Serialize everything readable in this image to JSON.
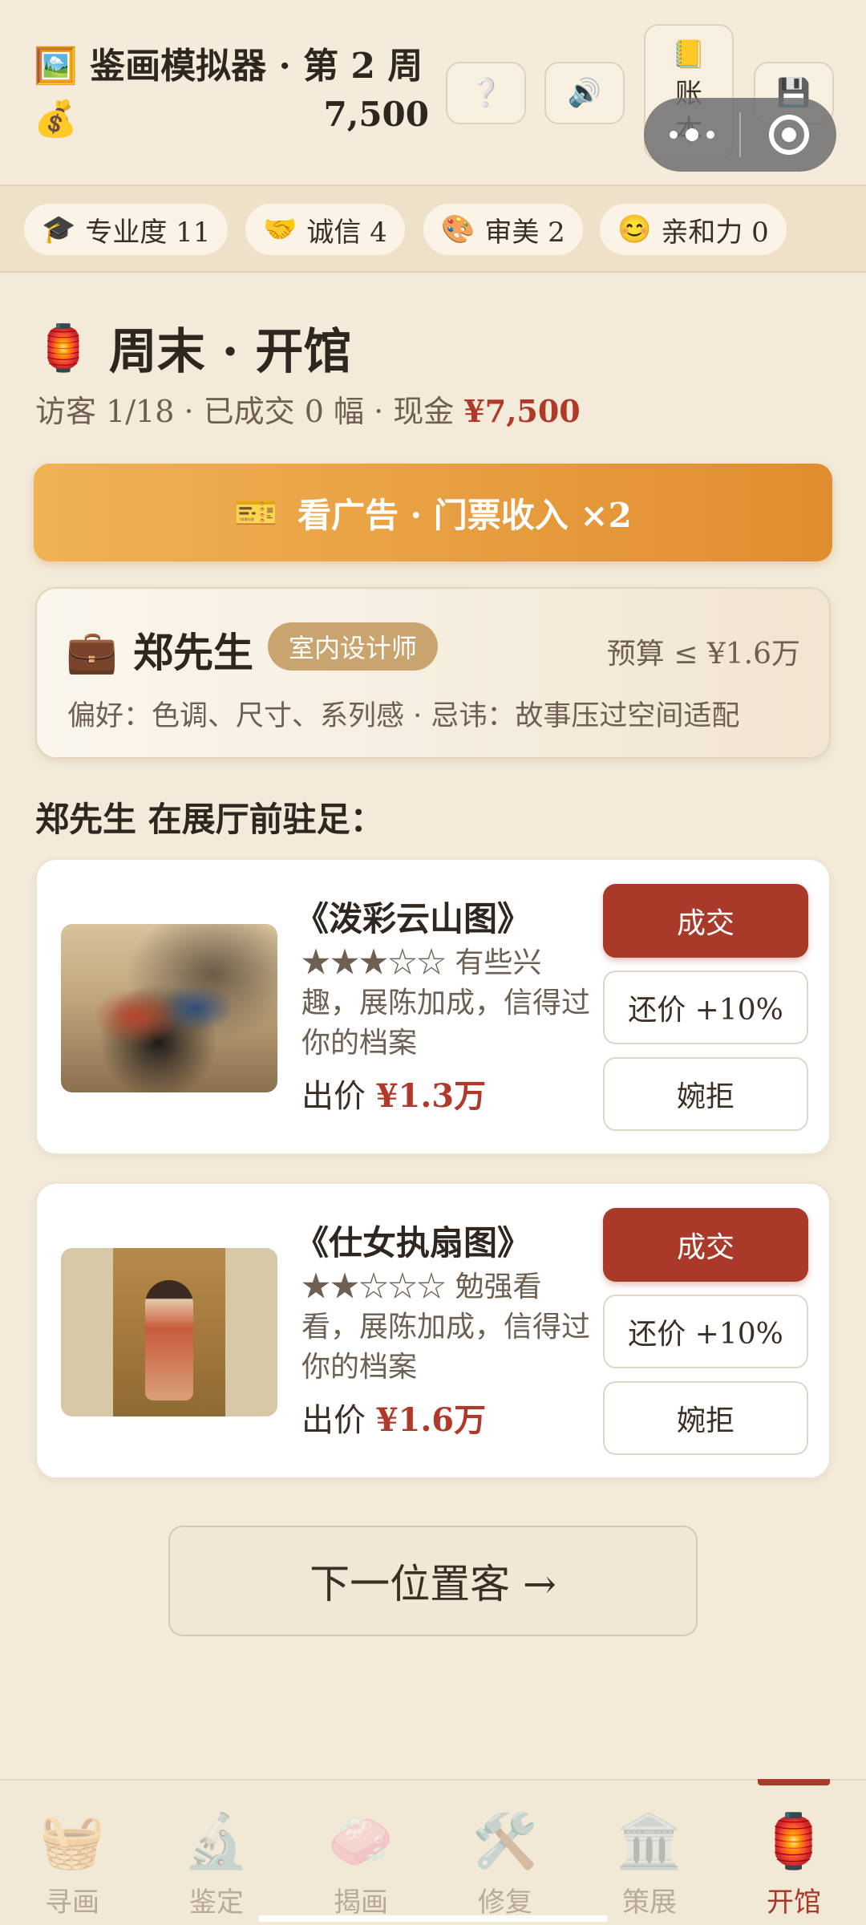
{
  "header": {
    "icon": "framed-picture",
    "title": "鉴画模拟器 · 第 2 周",
    "money_icon": "money-bag",
    "cash": "7,500",
    "help_glyph": "❔",
    "sound_icon": "speaker",
    "ledger_icon": "ledger-book",
    "ledger_label": "账本",
    "save_icon": "floppy-disk"
  },
  "stats": [
    {
      "icon": "graduation-cap",
      "label": "专业度 11"
    },
    {
      "icon": "handshake",
      "label": "诚信 4"
    },
    {
      "icon": "palette",
      "label": "审美 2"
    },
    {
      "icon": "smile",
      "label": "亲和力 0"
    }
  ],
  "session": {
    "icon": "lantern",
    "title": "周末 · 开馆",
    "subline_prefix": "访客 1/18 · 已成交 0 幅 · 现金 ",
    "cash": "¥7,500"
  },
  "ad_button": {
    "icon": "ticket",
    "label": "看广告 · 门票收入 ×2"
  },
  "customer": {
    "icon": "briefcase",
    "name": "郑先生",
    "role": "室内设计师",
    "budget": "预算 ≤ ¥1.6万",
    "prefs": "偏好：色调、尺寸、系列感 · 忌讳：故事压过空间适配"
  },
  "prompt": "郑先生 在展厅前驻足：",
  "offers": [
    {
      "title": "《泼彩云山图》",
      "desc": "★★★☆☆ 有些兴趣，展陈加成，信得过你的档案",
      "price_label": "出价 ",
      "price": "¥1.3万",
      "deal": "成交",
      "counter": "还价 +10%",
      "decline": "婉拒"
    },
    {
      "title": "《仕女执扇图》",
      "desc": "★★☆☆☆ 勉强看看，展陈加成，信得过你的档案",
      "price_label": "出价 ",
      "price": "¥1.6万",
      "deal": "成交",
      "counter": "还价 +10%",
      "decline": "婉拒"
    }
  ],
  "next_button": "下一位置客 →",
  "tabs": [
    {
      "icon": "basket",
      "label": "寻画"
    },
    {
      "icon": "microscope",
      "label": "鉴定"
    },
    {
      "icon": "soap",
      "label": "揭画"
    },
    {
      "icon": "tools",
      "label": "修复"
    },
    {
      "icon": "museum",
      "label": "策展"
    },
    {
      "icon": "lantern",
      "label": "开馆",
      "active": true
    }
  ],
  "colors": {
    "accent_red": "#a93a2a",
    "ad_orange": "#e08d2f",
    "background": "#f3ead9"
  }
}
